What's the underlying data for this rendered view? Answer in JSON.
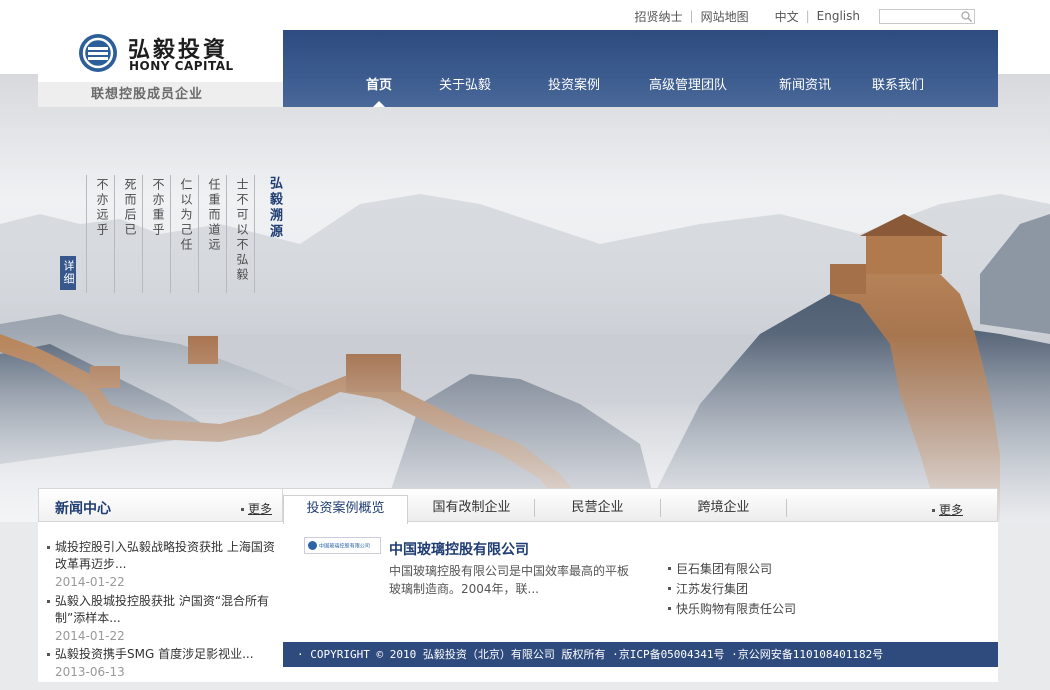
{
  "top_links": {
    "recruit": "招贤纳士",
    "sitemap": "网站地图",
    "lang_cn": "中文",
    "lang_en": "English"
  },
  "logo": {
    "name_cn": "弘毅投資",
    "name_en": "HONY CAPITAL",
    "tagline": "联想控股成员企业"
  },
  "nav": {
    "items": [
      "首页",
      "关于弘毅",
      "投资案例",
      "高级管理团队",
      "新闻资讯",
      "联系我们"
    ],
    "active": "首页"
  },
  "hero": {
    "title": "弘毅溯源",
    "poem": [
      "士不可以不弘毅",
      "任重而道远",
      "仁以为己任",
      "不亦重乎",
      "死而后已",
      "不亦远乎"
    ],
    "detail": "详细"
  },
  "news": {
    "title": "新闻中心",
    "more": "更多",
    "items": [
      {
        "text": "城投控股引入弘毅战略投资获批 上海国资改革再迈步...",
        "date": "2014-01-22"
      },
      {
        "text": "弘毅入股城投控股获批 沪国资“混合所有制”添样本...",
        "date": "2014-01-22"
      },
      {
        "text": "弘毅投资携手SMG 首度涉足影视业...",
        "date": "2013-06-13"
      }
    ]
  },
  "cases": {
    "tabs": [
      "投资案例概览",
      "国有改制企业",
      "民营企业",
      "跨境企业"
    ],
    "active_tab": "投资案例概览",
    "more": "更多",
    "featured": {
      "logo_text": "中国玻璃控股有限公司",
      "name": "中国玻璃控股有限公司",
      "description": "中国玻璃控股有限公司是中国效率最高的平板玻璃制造商。2004年，联..."
    },
    "list": [
      "巨石集团有限公司",
      "江苏发行集团",
      "快乐购物有限责任公司"
    ]
  },
  "footer": {
    "text": "· COPYRIGHT © 2010 弘毅投资（北京）有限公司 版权所有 ·京ICP备05004341号 ·京公网安备110108401182号"
  },
  "colors": {
    "nav_blue": "#2f4b7e",
    "title_blue": "#1f3d73"
  }
}
